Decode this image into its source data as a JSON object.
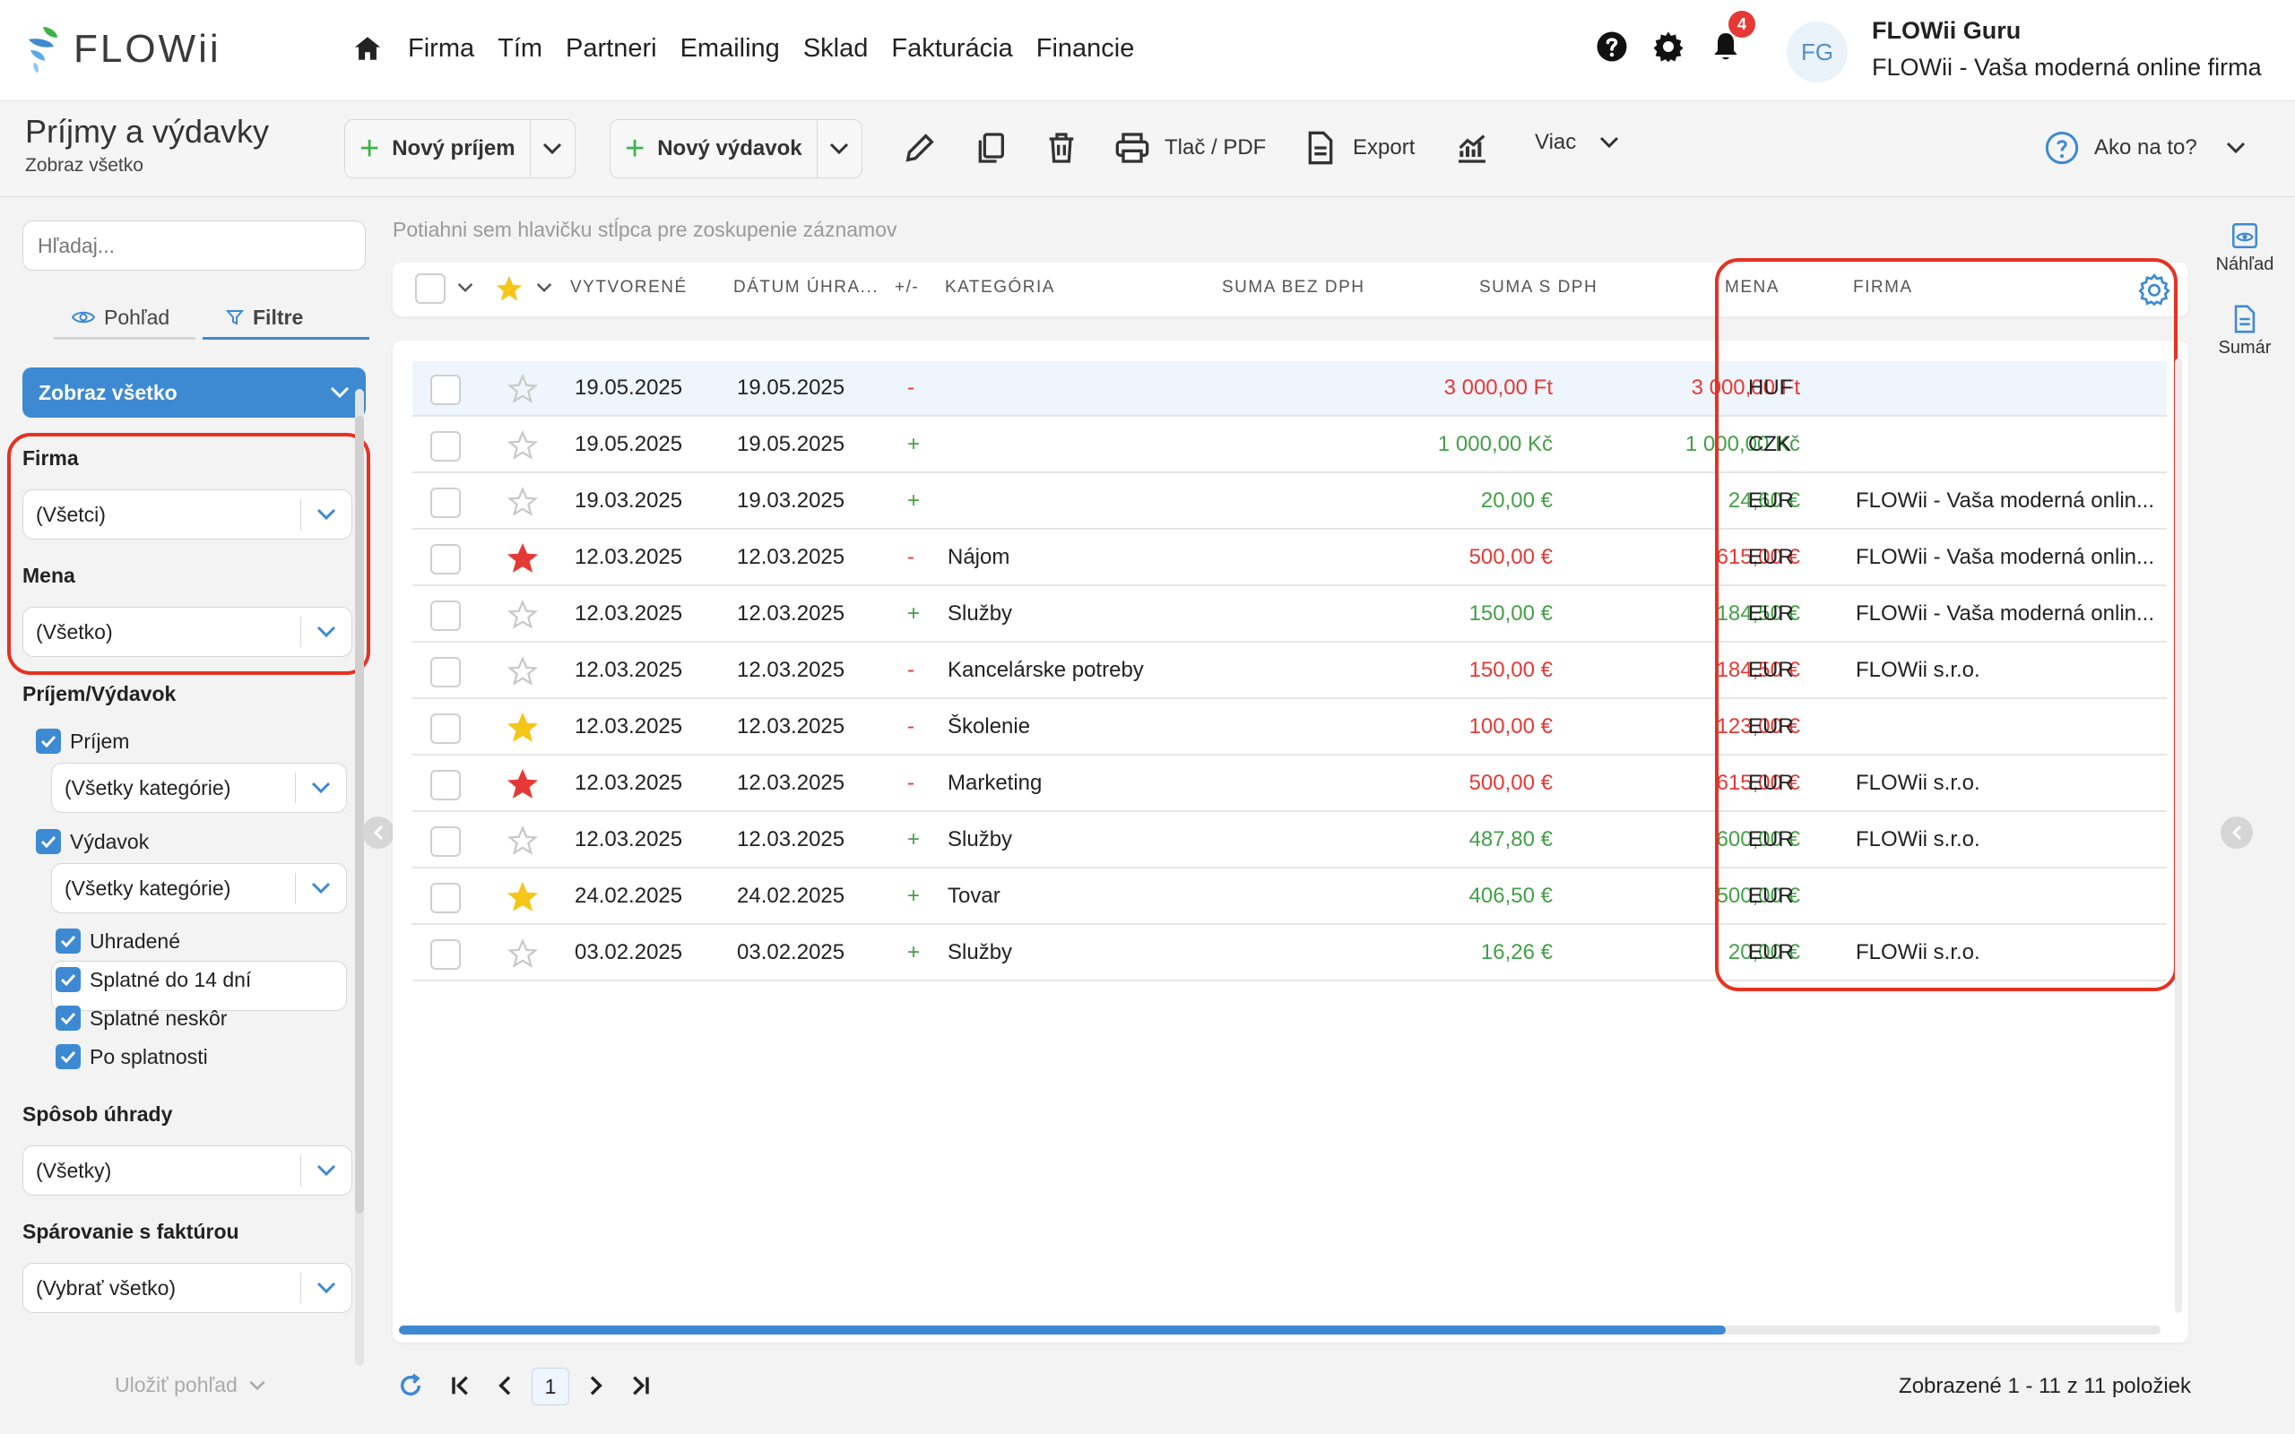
{
  "app": {
    "logo_text": "FLOWii",
    "nav": [
      "Firma",
      "Tím",
      "Partneri",
      "Emailing",
      "Sklad",
      "Fakturácia",
      "Financie"
    ],
    "notification_count": "4",
    "user_initials": "FG",
    "user_name": "FLOWii Guru",
    "user_company": "FLOWii - Vaša moderná online firma"
  },
  "toolbar": {
    "title": "Príjmy a výdavky",
    "subtitle": "Zobraz všetko",
    "new_income": "Nový príjem",
    "new_expense": "Nový výdavok",
    "print": "Tlač / PDF",
    "export": "Export",
    "more": "Viac",
    "help": "Ako na to?"
  },
  "sidebar": {
    "search_placeholder": "Hľadaj...",
    "tab_view": "Pohľad",
    "tab_filters": "Filtre",
    "show_all": "Zobraz všetko",
    "firma_label": "Firma",
    "firma_value": "(Všetci)",
    "mena_label": "Mena",
    "mena_value": "(Všetko)",
    "type_label": "Príjem/Výdavok",
    "income_label": "Príjem",
    "income_category": "(Všetky kategórie)",
    "expense_label": "Výdavok",
    "expense_category": "(Všetky kategórie)",
    "status": [
      "Uhradené",
      "Splatné do 14 dní",
      "Splatné neskôr",
      "Po splatnosti"
    ],
    "payment_label": "Spôsob úhrady",
    "payment_value": "(Všetky)",
    "pairing_label": "Spárovanie s faktúrou",
    "pairing_value": "(Vybrať všetko)",
    "save_view": "Uložiť pohľad"
  },
  "grid": {
    "group_hint": "Potiahni sem hlavičku stĺpca pre zoskupenie záznamov",
    "columns": [
      "VYTVORENÉ",
      "DÁTUM ÚHRA...",
      "+/-",
      "KATEGÓRIA",
      "SUMA BEZ DPH",
      "SUMA S DPH",
      "MENA",
      "FIRMA"
    ],
    "rows": [
      {
        "created": "19.05.2025",
        "paid": "19.05.2025",
        "sign": "-",
        "category": "",
        "net": "3 000,00 Ft",
        "gross": "3 000,00 Ft",
        "currency": "HUF",
        "company": "",
        "star": "none",
        "highlight": true
      },
      {
        "created": "19.05.2025",
        "paid": "19.05.2025",
        "sign": "+",
        "category": "",
        "net": "1 000,00 Kč",
        "gross": "1 000,00 Kč",
        "currency": "CZK",
        "company": "",
        "star": "none",
        "highlight": false
      },
      {
        "created": "19.03.2025",
        "paid": "19.03.2025",
        "sign": "+",
        "category": "",
        "net": "20,00 €",
        "gross": "24,60 €",
        "currency": "EUR",
        "company": "FLOWii - Vaša moderná onlin...",
        "star": "none",
        "highlight": false
      },
      {
        "created": "12.03.2025",
        "paid": "12.03.2025",
        "sign": "-",
        "category": "Nájom",
        "net": "500,00 €",
        "gross": "615,00 €",
        "currency": "EUR",
        "company": "FLOWii - Vaša moderná onlin...",
        "star": "red",
        "highlight": false
      },
      {
        "created": "12.03.2025",
        "paid": "12.03.2025",
        "sign": "+",
        "category": "Služby",
        "net": "150,00 €",
        "gross": "184,50 €",
        "currency": "EUR",
        "company": "FLOWii - Vaša moderná onlin...",
        "star": "none",
        "highlight": false
      },
      {
        "created": "12.03.2025",
        "paid": "12.03.2025",
        "sign": "-",
        "category": "Kancelárske potreby",
        "net": "150,00 €",
        "gross": "184,50 €",
        "currency": "EUR",
        "company": "FLOWii s.r.o.",
        "star": "none",
        "highlight": false
      },
      {
        "created": "12.03.2025",
        "paid": "12.03.2025",
        "sign": "-",
        "category": "Školenie",
        "net": "100,00 €",
        "gross": "123,00 €",
        "currency": "EUR",
        "company": "",
        "star": "yellow",
        "highlight": false
      },
      {
        "created": "12.03.2025",
        "paid": "12.03.2025",
        "sign": "-",
        "category": "Marketing",
        "net": "500,00 €",
        "gross": "615,00 €",
        "currency": "EUR",
        "company": "FLOWii s.r.o.",
        "star": "red",
        "highlight": false
      },
      {
        "created": "12.03.2025",
        "paid": "12.03.2025",
        "sign": "+",
        "category": "Služby",
        "net": "487,80 €",
        "gross": "600,00 €",
        "currency": "EUR",
        "company": "FLOWii s.r.o.",
        "star": "none",
        "highlight": false
      },
      {
        "created": "24.02.2025",
        "paid": "24.02.2025",
        "sign": "+",
        "category": "Tovar",
        "net": "406,50 €",
        "gross": "500,00 €",
        "currency": "EUR",
        "company": "",
        "star": "yellow",
        "highlight": false
      },
      {
        "created": "03.02.2025",
        "paid": "03.02.2025",
        "sign": "+",
        "category": "Služby",
        "net": "16,26 €",
        "gross": "20,00 €",
        "currency": "EUR",
        "company": "FLOWii s.r.o.",
        "star": "none",
        "highlight": false
      }
    ],
    "pager_page": "1",
    "pager_info": "Zobrazené 1 - 11 z 11 položiek"
  },
  "right_panel": {
    "preview": "Náhľad",
    "summary": "Sumár"
  },
  "colors": {
    "accent": "#3d8ad3",
    "income": "#43a047",
    "expense": "#e53935",
    "highlight_frame": "#e53222",
    "star_red": "#e53935",
    "star_yellow": "#f5c518"
  }
}
